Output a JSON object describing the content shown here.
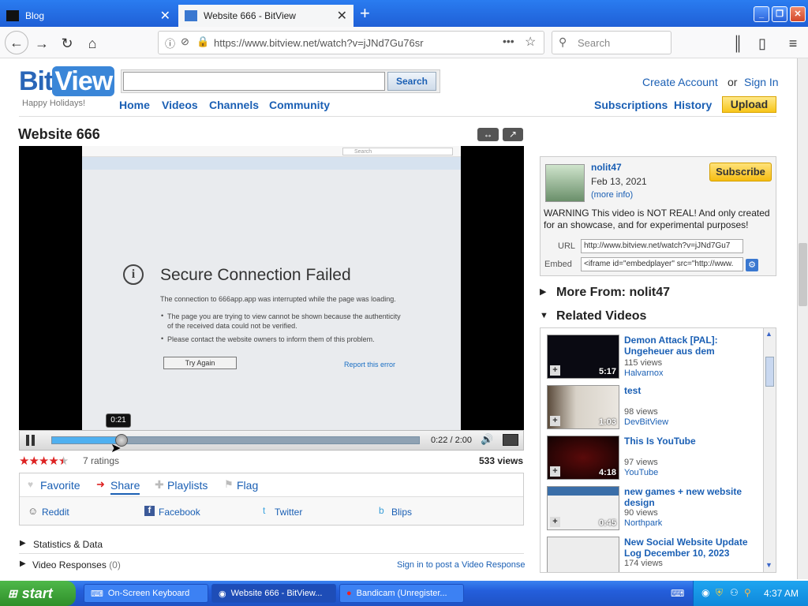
{
  "browser": {
    "tabs": [
      {
        "title": "Blog"
      },
      {
        "title": "Website 666 - BitView"
      }
    ],
    "url": "https://www.bitview.net/watch?v=jJNd7Gu76sr",
    "search_placeholder": "Search"
  },
  "site": {
    "logo_bit": "Bit",
    "logo_view": "View",
    "tagline": "Happy Holidays!",
    "search_button": "Search",
    "nav": [
      "Home",
      "Videos",
      "Channels",
      "Community"
    ],
    "create_account": "Create Account",
    "or": "or",
    "sign_in": "Sign In",
    "subscriptions": "Subscriptions",
    "history": "History",
    "upload": "Upload"
  },
  "video": {
    "title": "Website 666",
    "screen_search": "Search",
    "error_title": "Secure Connection Failed",
    "error_line1": "The connection to 666app.app was interrupted while the page was loading.",
    "error_bullet1a": "The page you are trying to view cannot be shown because the authenticity",
    "error_bullet1b": "of the received data could not be verified.",
    "error_bullet2": "Please contact the website owners to inform them of this problem.",
    "try_again": "Try Again",
    "report": "Report this error",
    "tooltip_time": "0:21",
    "time": "0:22 / 2:00",
    "progress": 0.19,
    "ratings": "7 ratings",
    "stars": 4.5,
    "views": "533 views",
    "actions": [
      "Favorite",
      "Share",
      "Playlists",
      "Flag"
    ],
    "share_targets": [
      "Reddit",
      "Facebook",
      "Twitter",
      "Blips"
    ],
    "stats": "Statistics & Data",
    "responses": "Video Responses",
    "responses_count": "(0)",
    "post_response": "Sign in to post a Video Response"
  },
  "uploader": {
    "name": "nolit47",
    "date": "Feb 13, 2021",
    "more_info": "(more info)",
    "subscribe": "Subscribe",
    "description": "WARNING This video is NOT REAL! And only created for an showcase, and for experimental purposes!",
    "url_label": "URL",
    "url_value": "http://www.bitview.net/watch?v=jJNd7Gu7",
    "embed_label": "Embed",
    "embed_value": "<iframe id=\"embedplayer\" src=\"http://www."
  },
  "more_from": "More From: nolit47",
  "related_heading": "Related Videos",
  "related": [
    {
      "title": "Demon Attack [PAL]: Ungeheuer aus dem",
      "views": "115 views",
      "user": "Halvarnox",
      "dur": "5:17"
    },
    {
      "title": "test",
      "views": "98 views",
      "user": "DevBitView",
      "dur": "1:03"
    },
    {
      "title": "This Is YouTube",
      "views": "97 views",
      "user": "YouTube",
      "dur": "4:18"
    },
    {
      "title": "new games + new website design",
      "views": "90 views",
      "user": "Northpark",
      "dur": "0:45"
    },
    {
      "title": "New Social Website Update Log December 10, 2023",
      "views": "174 views",
      "user": "",
      "dur": ""
    }
  ],
  "taskbar": {
    "start": "start",
    "tasks": [
      "On-Screen Keyboard",
      "Website 666 - BitView...",
      "Bandicam (Unregister..."
    ],
    "clock": "4:37 AM"
  }
}
